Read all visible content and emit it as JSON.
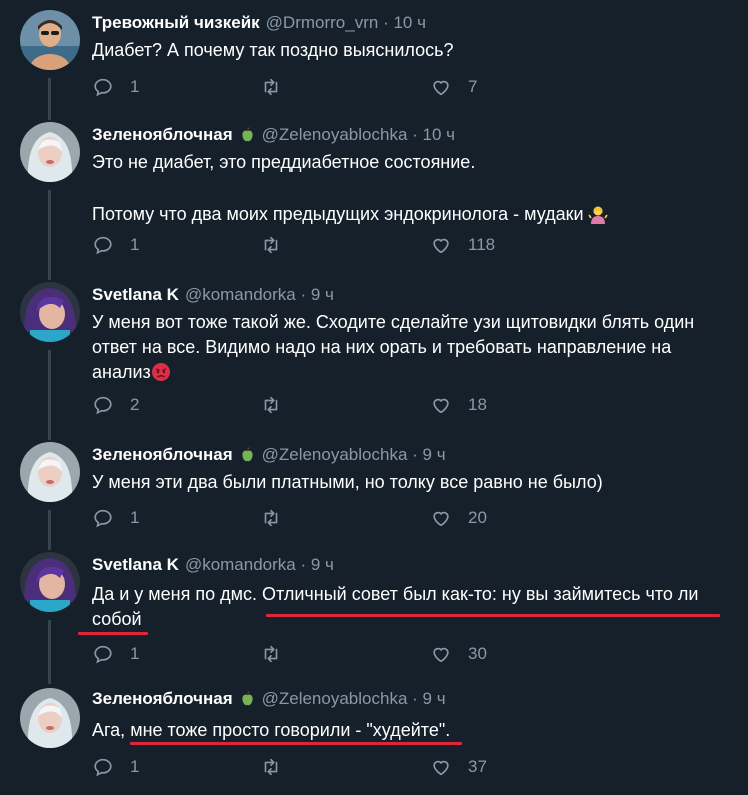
{
  "tweets": [
    {
      "name": "Тревожный чизкейк",
      "handle": "@Drmorro_vrn",
      "time": "10 ч",
      "lines": [
        "Диабет? А почему так поздно выяснилось?"
      ],
      "replies": "1",
      "likes": "7"
    },
    {
      "name": "Зеленояблочная",
      "handle": "@Zelenoyablochka",
      "time": "10 ч",
      "lines": [
        "Это не диабет, это преддиабетное состояние.",
        "",
        "Потому что два моих предыдущих эндокринолога - мудаки"
      ],
      "replies": "1",
      "likes": "118"
    },
    {
      "name": "Svetlana K",
      "handle": "@komandorka",
      "time": "9 ч",
      "lines": [
        "У меня вот тоже такой же. Сходите сделайте узи щитовидки блять один",
        "ответ на все. Видимо надо на них орать и требовать направление на",
        "анализ"
      ],
      "replies": "2",
      "likes": "18"
    },
    {
      "name": "Зеленояблочная",
      "handle": "@Zelenoyablochka",
      "time": "9 ч",
      "lines": [
        "У меня эти два были платными, но толку все равно не было)"
      ],
      "replies": "1",
      "likes": "20"
    },
    {
      "name": "Svetlana K",
      "handle": "@komandorka",
      "time": "9 ч",
      "lines": [
        "Да и у меня по дмс. Отличный совет был как-то: ну вы займитесь что ли",
        "собой"
      ],
      "replies": "1",
      "likes": "30"
    },
    {
      "name": "Зеленояблочная",
      "handle": "@Zelenoyablochka",
      "time": "9 ч",
      "lines": [
        "Ага, мне тоже просто говорили - \"худейте\"."
      ],
      "replies": "1",
      "likes": "37"
    }
  ],
  "icons": {
    "reply": "reply-icon",
    "retweet": "retweet-icon",
    "like": "heart-icon"
  },
  "colors": {
    "background": "#15202b",
    "muted": "#8899a6",
    "underline": "#e0243a",
    "thread_line": "#38444d"
  }
}
